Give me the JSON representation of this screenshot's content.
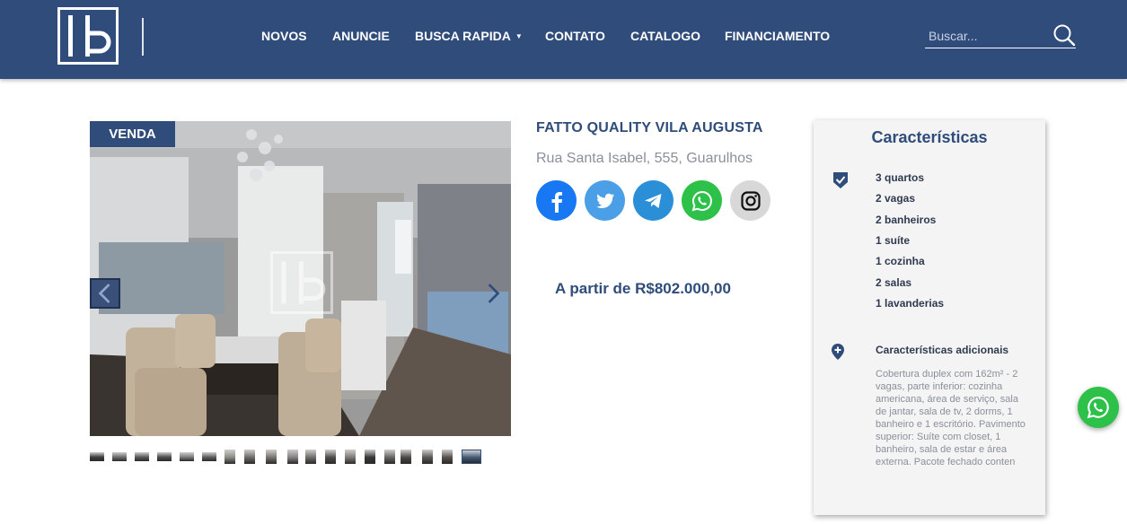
{
  "header": {
    "nav": [
      {
        "label": "NOVOS"
      },
      {
        "label": "ANUNCIE"
      },
      {
        "label": "BUSCA RAPIDA"
      },
      {
        "label": "CONTATO"
      },
      {
        "label": "CATALOGO"
      },
      {
        "label": "FINANCIAMENTO"
      }
    ],
    "search_placeholder": "Buscar..."
  },
  "listing": {
    "badge": "VENDA",
    "title": "FATTO QUALITY VILA AUGUSTA",
    "address": "Rua Santa Isabel, 555, Guarulhos",
    "price": "A partir de R$802.000,00",
    "social_icons": [
      "facebook-icon",
      "twitter-icon",
      "telegram-icon",
      "whatsapp-icon",
      "instagram-icon"
    ],
    "thumbnail_count": 19
  },
  "features": {
    "title": "Características",
    "items": [
      "3 quartos",
      "2 vagas",
      "2 banheiros",
      "1 suíte",
      "1 cozinha",
      "2 salas",
      "1 lavanderias"
    ],
    "additional_title": "Características adicionais",
    "additional_text": "Cobertura duplex com 162m² - 2 vagas, parte inferior: cozinha americana, área de serviço, sala de jantar, sala de tv, 2 dorms, 1 banheiro e 1 escritório. Pavimento superior: Suíte com closet, 1 banheiro, sala de estar e área externa. Pacote fechado conten"
  },
  "colors": {
    "brand": "#2f4c7a",
    "facebook": "#1877f2",
    "twitter": "#4a9fe6",
    "telegram": "#2a8fd6",
    "whatsapp": "#2ec14a",
    "instagram": "#d8d8d8"
  }
}
